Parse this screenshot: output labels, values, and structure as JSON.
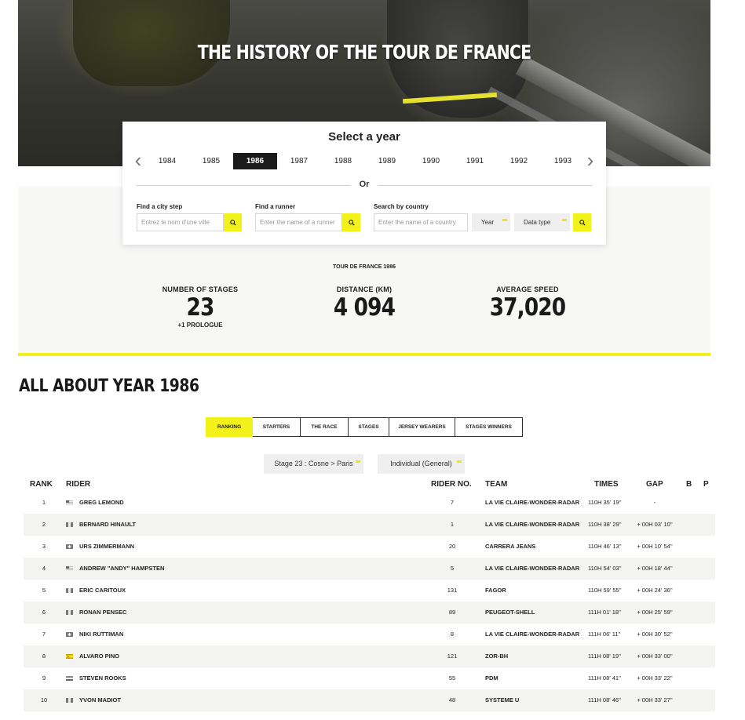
{
  "hero": {
    "title": "THE HISTORY OF THE TOUR DE FRANCE"
  },
  "selector": {
    "title": "Select a year",
    "years": [
      "1984",
      "1985",
      "1986",
      "1987",
      "1988",
      "1989",
      "1990",
      "1991",
      "1992",
      "1993"
    ],
    "selected_year": "1986",
    "or_label": "Or"
  },
  "search": {
    "city_label": "Find a city step",
    "city_placeholder": "Entrez le nom d'une ville",
    "runner_label": "Find a runner",
    "runner_placeholder": "Enter the name of a runner",
    "country_label": "Search by country",
    "country_placeholder": "Enter the name of a country",
    "year_select": "Year",
    "data_type_select": "Data type"
  },
  "stats": {
    "heading": "TOUR DE FRANCE 1986",
    "stages_label": "NUMBER OF STAGES",
    "stages_value": "23",
    "stages_sub": "+1 PROLOGUE",
    "distance_label": "DISTANCE (KM)",
    "distance_value": "4 094",
    "speed_label": "AVERAGE SPEED",
    "speed_value": "37,020"
  },
  "about": {
    "title": "ALL ABOUT YEAR 1986",
    "tabs": [
      "RANKING",
      "STARTERS",
      "THE RACE",
      "STAGES",
      "JERSEY WEARERS",
      "STAGES WINNERS"
    ],
    "active_tab": "RANKING",
    "stage_filter": "Stage 23 : Cosne > Paris",
    "ranking_filter": "Individual (General)"
  },
  "table": {
    "headers": {
      "rank": "RANK",
      "rider": "RIDER",
      "rider_no": "RIDER NO.",
      "team": "TEAM",
      "times": "TIMES",
      "gap": "GAP",
      "b": "B",
      "p": "P"
    },
    "rows": [
      {
        "rank": "1",
        "rider": "GREG LEMOND",
        "flag": "usa",
        "no": "7",
        "team": "LA VIE CLAIRE-WONDER-RADAR",
        "time": "110H 35' 19''",
        "gap": "-"
      },
      {
        "rank": "2",
        "rider": "BERNARD HINAULT",
        "flag": "france",
        "no": "1",
        "team": "LA VIE CLAIRE-WONDER-RADAR",
        "time": "110H 38' 29''",
        "gap": "+ 00H 03' 10''"
      },
      {
        "rank": "3",
        "rider": "URS ZIMMERMANN",
        "flag": "switzerland",
        "no": "20",
        "team": "CARRERA JEANS",
        "time": "110H 46' 13''",
        "gap": "+ 00H 10' 54''"
      },
      {
        "rank": "4",
        "rider": "ANDREW \"ANDY\" HAMPSTEN",
        "flag": "usa",
        "no": "5",
        "team": "LA VIE CLAIRE-WONDER-RADAR",
        "time": "110H 54' 03''",
        "gap": "+ 00H 18' 44''"
      },
      {
        "rank": "5",
        "rider": "ERIC CARITOUX",
        "flag": "france",
        "no": "131",
        "team": "FAGOR",
        "time": "110H 59' 55''",
        "gap": "+ 00H 24' 36''"
      },
      {
        "rank": "6",
        "rider": "RONAN PENSEC",
        "flag": "france",
        "no": "89",
        "team": "PEUGEOT-SHELL",
        "time": "111H 01' 18''",
        "gap": "+ 00H 25' 59''"
      },
      {
        "rank": "7",
        "rider": "NIKI RUTTIMAN",
        "flag": "switzerland",
        "no": "8",
        "team": "LA VIE CLAIRE-WONDER-RADAR",
        "time": "111H 06' 11''",
        "gap": "+ 00H 30' 52''"
      },
      {
        "rank": "8",
        "rider": "ALVARO PINO",
        "flag": "spain",
        "no": "121",
        "team": "ZOR-BH",
        "time": "111H 08' 19''",
        "gap": "+ 00H 33' 00''"
      },
      {
        "rank": "9",
        "rider": "STEVEN ROOKS",
        "flag": "netherlands",
        "no": "55",
        "team": "PDM",
        "time": "111H 08' 41''",
        "gap": "+ 00H 33' 22''"
      },
      {
        "rank": "10",
        "rider": "YVON MADIOT",
        "flag": "france",
        "no": "48",
        "team": "SYSTEME U",
        "time": "111H 08' 46''",
        "gap": "+ 00H 33' 27''"
      }
    ]
  },
  "colors": {
    "accent": "#f3f11a",
    "dark": "#1b1b1b",
    "row_alt": "#f3f3f2"
  }
}
